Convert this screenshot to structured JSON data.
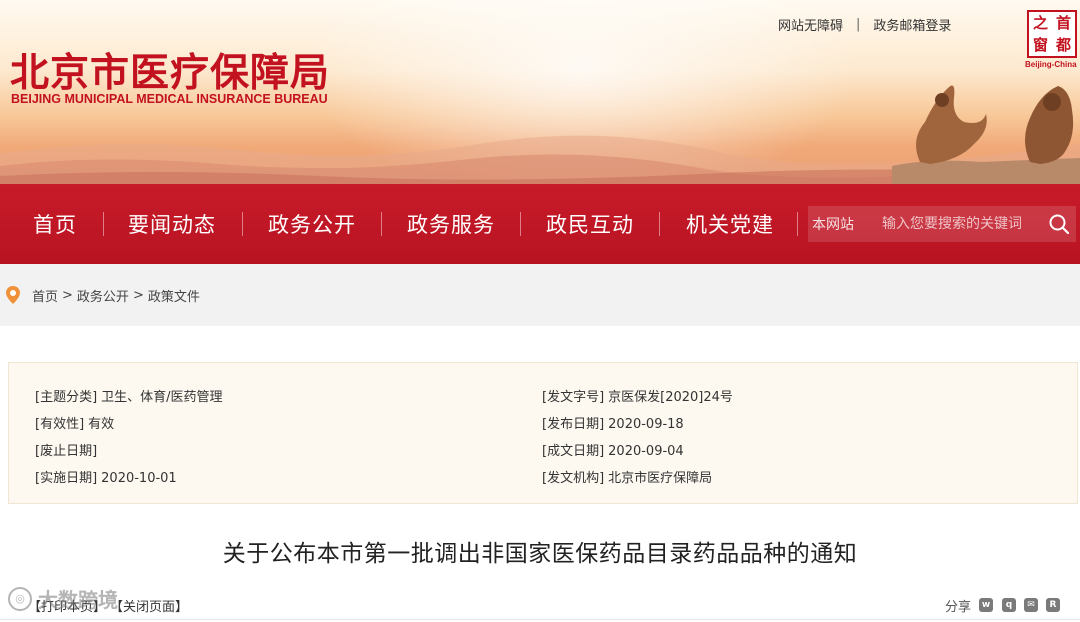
{
  "header": {
    "title": "北京市医疗保障局",
    "subtitle": "BEIJING MUNICIPAL MEDICAL INSURANCE BUREAU",
    "top_links": [
      "网站无障碍",
      "政务邮箱登录"
    ],
    "top_link_separator": "|",
    "seal": {
      "chars": [
        "首",
        "之",
        "都",
        "窗"
      ],
      "caption": "Beijing-China"
    }
  },
  "nav": {
    "items": [
      {
        "label": "首页"
      },
      {
        "label": "要闻动态"
      },
      {
        "label": "政务公开"
      },
      {
        "label": "政务服务"
      },
      {
        "label": "政民互动"
      },
      {
        "label": "机关党建"
      }
    ],
    "search": {
      "scope": "本网站",
      "placeholder": "输入您要搜索的关键词"
    }
  },
  "breadcrumb": {
    "items": [
      "首页",
      "政务公开",
      "政策文件"
    ],
    "separator": ">"
  },
  "meta": {
    "left": [
      {
        "key": "[主题分类]",
        "value": "卫生、体育/医药管理"
      },
      {
        "key": "[有效性]",
        "value": "有效"
      },
      {
        "key": "[废止日期]",
        "value": ""
      },
      {
        "key": "[实施日期]",
        "value": "2020-10-01"
      }
    ],
    "right": [
      {
        "key": "[发文字号]",
        "value": "京医保发[2020]24号"
      },
      {
        "key": "[发布日期]",
        "value": "2020-09-18"
      },
      {
        "key": "[成文日期]",
        "value": "2020-09-04"
      },
      {
        "key": "[发文机构]",
        "value": "北京市医疗保障局"
      }
    ]
  },
  "article": {
    "title": "关于公布本市第一批调出非国家医保药品目录药品品种的通知"
  },
  "tools": {
    "print_label": "【打印本页】",
    "close_label": "【关闭页面】",
    "share_label": "分享"
  },
  "watermark": {
    "text": "大数跨境"
  },
  "colors": {
    "brand_red": "#c3121f",
    "nav_red": "#c81b29",
    "pin_orange": "#f0913a"
  }
}
